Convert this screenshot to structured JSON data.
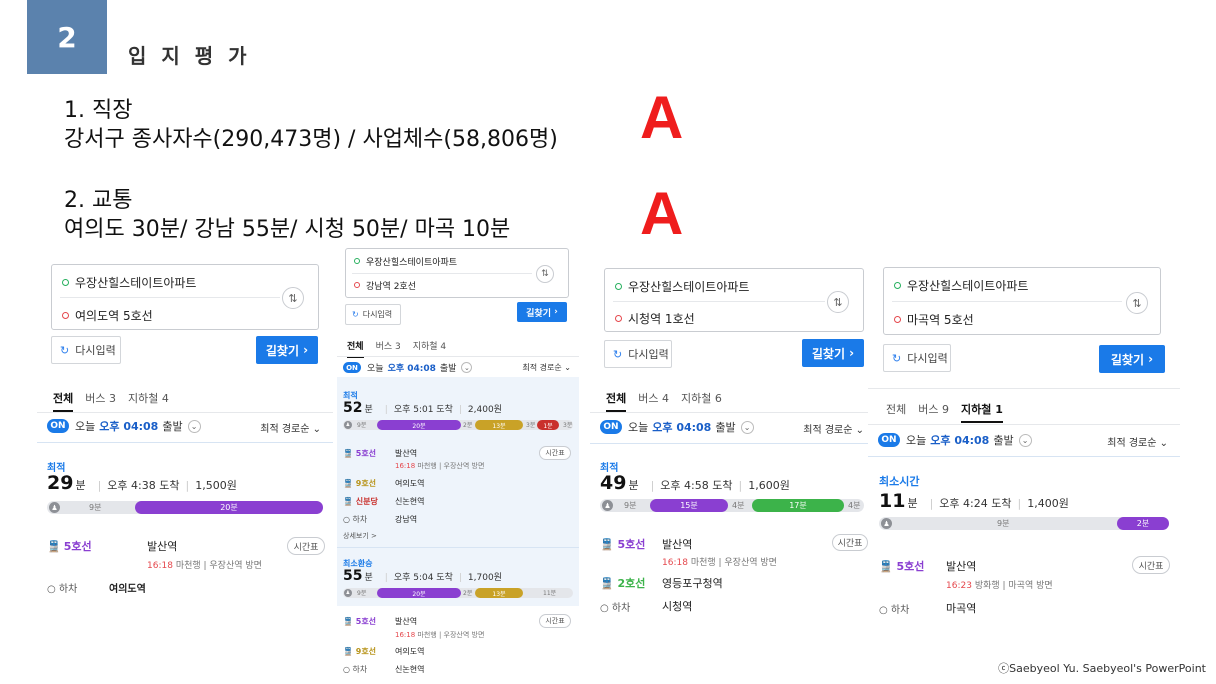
{
  "slide": {
    "number": "2",
    "title": "입 지 평 가",
    "section1_heading": "1.  직장",
    "section1_text": "강서구 종사자수(290,473명) / 사업체수(58,806명)",
    "section1_grade": "A",
    "section2_heading": "2. 교통",
    "section2_text": "여의도 30분/ 강남 55분/ 시청 50분/ 마곡 10분",
    "section2_grade": "A",
    "copyright": "ⓒSaebyeol Yu.  Saebyeol's PowerPoint",
    "accent_colors": {
      "badge": "#5b82ad",
      "grade": "#ef1d1d",
      "map_blue": "#1a7ae8"
    }
  },
  "common": {
    "reset_label": "다시입력",
    "search_label": "길찾기",
    "tab_all": "전체",
    "depart_on": "ON",
    "depart_text": "오늘",
    "depart_time": "오후 04:08",
    "depart_suffix": "출발",
    "sort_label": "최적 경로순",
    "timetable_label": "시간표",
    "alight_label": "하차",
    "unit_min": "분"
  },
  "panels": {
    "yeouido": {
      "origin": "우장산힐스테이트아파트",
      "destination": "여의도역 5호선",
      "tab_bus": "버스 3",
      "tab_subway": "지하철 4",
      "route_label": "최적",
      "duration": "29",
      "arrival": "오후 4:38 도착",
      "fare": "1,500원",
      "bar": {
        "walk": "9분",
        "seg1": "20분"
      },
      "line1": "5호선",
      "board_station": "발산역",
      "board_time": "16:18",
      "board_info": "마천행 | 우장산역 방면",
      "alight_station": "여의도역"
    },
    "gangnam": {
      "origin": "우장산힐스테이트아파트",
      "destination": "강남역 2호선",
      "tab_bus": "버스 3",
      "tab_subway": "지하철 4",
      "route1_label": "최적",
      "route1_duration": "52",
      "route1_arrival": "오후 5:01 도착",
      "route1_fare": "2,400원",
      "route1_bar": {
        "walk": "9분",
        "s1": "20분",
        "gap1": "2분",
        "s2": "13분",
        "gap2": "3분",
        "s3": "1분",
        "end": "3분"
      },
      "r1_line1": "5호선",
      "r1_stop1": "발산역",
      "r1_time": "16:18",
      "r1_info": "마천행 | 우장산역 방면",
      "r1_line2": "9호선",
      "r1_stop2": "여의도역",
      "r1_line3": "신분당",
      "r1_stop3": "신논현역",
      "r1_stop4": "강남역",
      "more_label": "상세보기 >",
      "route2_label": "최소환승",
      "route2_duration": "55",
      "route2_arrival": "오후 5:04 도착",
      "route2_fare": "1,700원",
      "route2_bar": {
        "walk": "9분",
        "s1": "20분",
        "gap1": "2분",
        "s2": "13분",
        "end": "11분"
      },
      "r2_line1": "5호선",
      "r2_stop1": "발산역",
      "r2_time": "16:18",
      "r2_info": "마천행 | 우장산역 방면",
      "r2_line2": "9호선",
      "r2_stop2": "여의도역",
      "r2_stop3": "신논현역"
    },
    "cityhall": {
      "origin": "우장산힐스테이트아파트",
      "destination": "시청역 1호선",
      "tab_bus": "버스 4",
      "tab_subway": "지하철 6",
      "route_label": "최적",
      "duration": "49",
      "arrival": "오후 4:58 도착",
      "fare": "1,600원",
      "bar": {
        "walk": "9분",
        "s1": "15분",
        "gap": "4분",
        "s2": "17분",
        "end": "4분"
      },
      "line1": "5호선",
      "stop1": "발산역",
      "time": "16:18",
      "info": "마천행 | 우장산역 방면",
      "line2": "2호선",
      "stop2": "영등포구청역",
      "stop3": "시청역"
    },
    "magok": {
      "origin": "우장산힐스테이트아파트",
      "destination": "마곡역 5호선",
      "tab_bus": "버스 9",
      "tab_subway": "지하철 1",
      "route_label": "최소시간",
      "duration": "11",
      "arrival": "오후 4:24 도착",
      "fare": "1,400원",
      "bar": {
        "walk": "9분",
        "s1": "2분"
      },
      "line1": "5호선",
      "stop1": "발산역",
      "time": "16:23",
      "info": "방화행 | 마곡역 방면",
      "stop2": "마곡역"
    }
  }
}
